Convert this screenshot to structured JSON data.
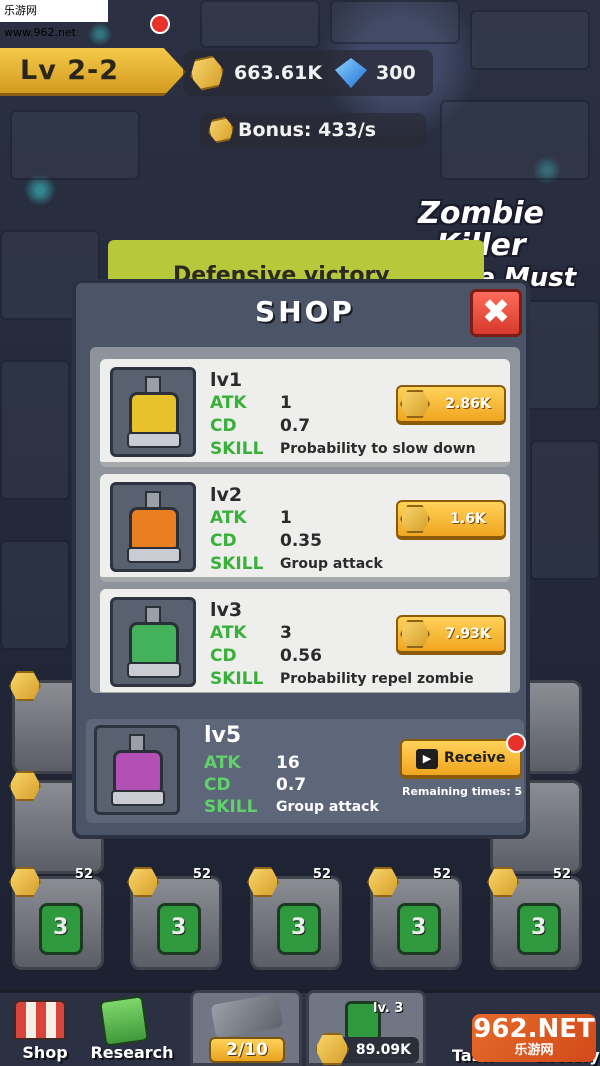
{
  "watermark": "乐游网 www.962.net",
  "header": {
    "level": "Lv 2-2",
    "gold": "663.61K",
    "gems": "300",
    "bonus": "Bonus: 433/s"
  },
  "logo": {
    "line1": "Zombie Killer",
    "line2": "Zombie Must Die!"
  },
  "behind_banner": "Defensive victory",
  "shop": {
    "title": "SHOP",
    "close_label": "✖",
    "items": [
      {
        "level": "lv1",
        "atk_label": "ATK",
        "atk": "1",
        "cd_label": "CD",
        "cd": "0.7",
        "skill_label": "SKILL",
        "skill": "Probability to slow down",
        "price": "2.86K",
        "color": "#e7c22a"
      },
      {
        "level": "lv2",
        "atk_label": "ATK",
        "atk": "1",
        "cd_label": "CD",
        "cd": "0.35",
        "skill_label": "SKILL",
        "skill": "Group attack",
        "price": "1.6K",
        "color": "#ea7f22"
      },
      {
        "level": "lv3",
        "atk_label": "ATK",
        "atk": "3",
        "cd_label": "CD",
        "cd": "0.56",
        "skill_label": "SKILL",
        "skill": "Probability repel zombie",
        "price": "7.93K",
        "color": "#43b25b"
      }
    ],
    "reward": {
      "level": "lv5",
      "atk_label": "ATK",
      "atk": "16",
      "cd_label": "CD",
      "cd": "0.7",
      "skill_label": "SKILL",
      "skill": "Group attack",
      "receive_label": "Receive",
      "remaining": "Remaining times: 5",
      "color": "#b44fb5"
    }
  },
  "grid": {
    "bottom_row_level": "52",
    "bottom_row_value": "3"
  },
  "bottom_nav": {
    "shop_label": "Shop",
    "research_label": "Research",
    "tool_counter": "2/10",
    "buy_level": "lv. 3",
    "buy_price": "89.09K",
    "task_label": "Task",
    "lottery_label": "Lottery"
  },
  "corner_watermark": {
    "main": "962.NET",
    "sub": "乐游网"
  }
}
